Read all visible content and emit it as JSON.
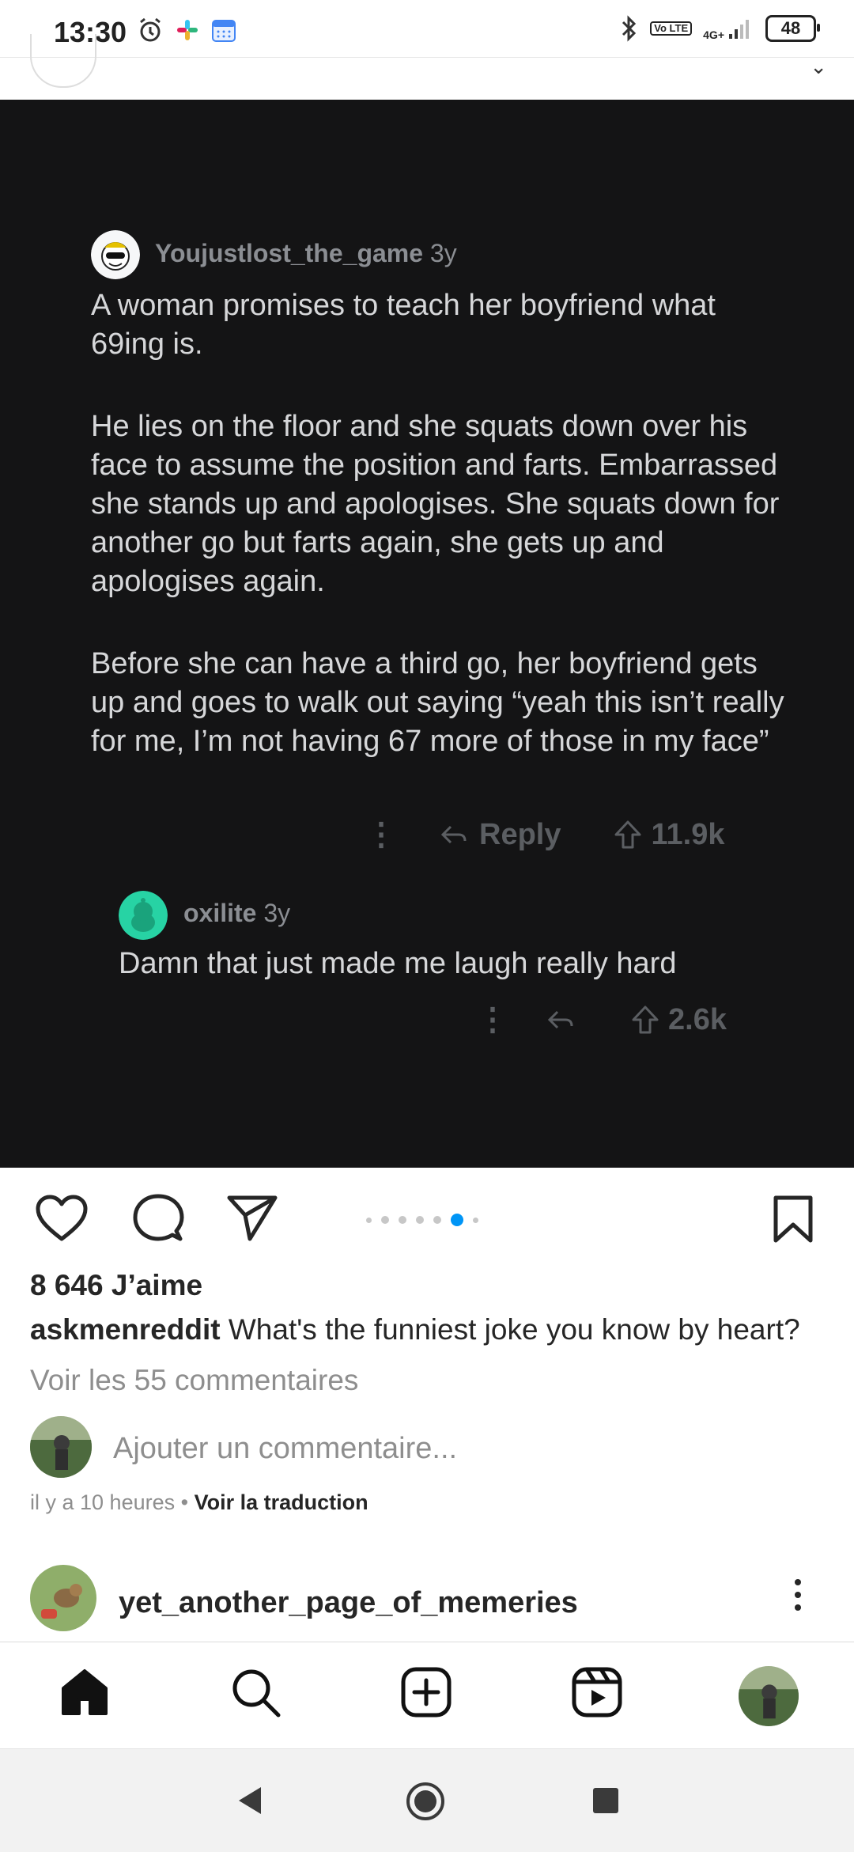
{
  "status_bar": {
    "time": "13:30",
    "network": "4G+",
    "volte": "Vo LTE",
    "battery": "48",
    "icons": [
      "alarm-icon",
      "slack-icon",
      "calendar-icon",
      "bluetooth-icon",
      "signal-icon"
    ]
  },
  "post": {
    "comments": [
      {
        "username": "Youjustlost_the_game",
        "age": "3y",
        "paragraphs": [
          "A woman promises to teach her boyfriend what 69ing is.",
          "He lies on the floor and she squats down over his face to assume the position and farts. Embarrassed she stands up and apologises. She squats down for another go but farts again, she gets up and apologises again.",
          "Before she can have a third go, her boyfriend gets up and goes to walk out saying “yeah this isn’t really for me, I’m not having 67 more of those in my face”"
        ],
        "reply_label": "Reply",
        "votes": "11.9k"
      },
      {
        "username": "oxilite",
        "age": "3y",
        "text": "Damn that just made me laugh really hard",
        "votes": "2.6k"
      }
    ],
    "likes": "8 646 J’aime",
    "caption_user": "askmenreddit",
    "caption_text": "What's the funniest joke you know by heart?",
    "view_comments": "Voir les 55 commentaires",
    "add_comment_placeholder": "Ajouter un commentaire...",
    "time_ago": "il y a 10 heures",
    "separator": "•",
    "see_translation": "Voir la traduction",
    "carousel": {
      "count": 7,
      "active_index": 5
    }
  },
  "next_post": {
    "username": "yet_another_page_of_memeries"
  },
  "colors": {
    "accent": "#0095f6",
    "media_background": "#141415",
    "reddit_text": "#d6d7d9",
    "reddit_muted": "#5b5e62"
  }
}
